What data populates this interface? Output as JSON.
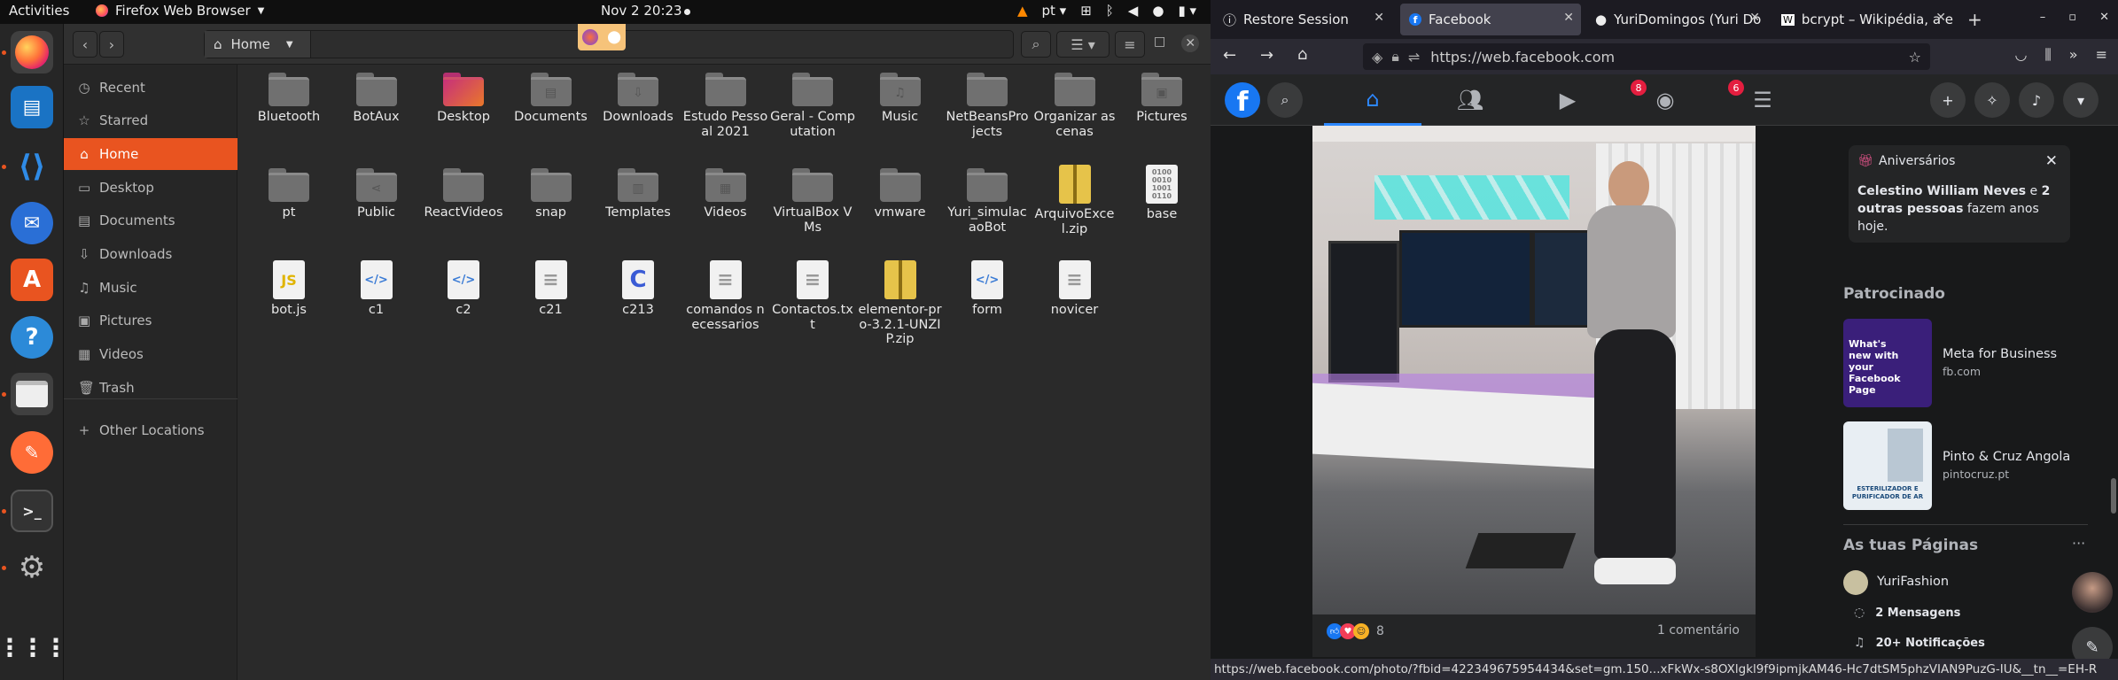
{
  "topbar": {
    "activities": "Activities",
    "app_name": "Firefox Web Browser",
    "clock": "Nov 2  20:23",
    "lang": "pt"
  },
  "nautilus": {
    "location": "Home",
    "sidebar": [
      {
        "label": "Recent",
        "icon": "clock-icon"
      },
      {
        "label": "Starred",
        "icon": "star-icon"
      },
      {
        "label": "Home",
        "icon": "home-icon",
        "selected": true
      },
      {
        "label": "Desktop",
        "icon": "desktop-icon"
      },
      {
        "label": "Documents",
        "icon": "documents-icon"
      },
      {
        "label": "Downloads",
        "icon": "download-icon"
      },
      {
        "label": "Music",
        "icon": "music-icon"
      },
      {
        "label": "Pictures",
        "icon": "pictures-icon"
      },
      {
        "label": "Videos",
        "icon": "videos-icon"
      },
      {
        "label": "Trash",
        "icon": "trash-icon"
      },
      {
        "label": "Other Locations",
        "icon": "plus-icon"
      }
    ],
    "files": [
      {
        "name": "Bluetooth",
        "kind": "folder"
      },
      {
        "name": "BotAux",
        "kind": "folder"
      },
      {
        "name": "Desktop",
        "kind": "desktop"
      },
      {
        "name": "Documents",
        "kind": "folder",
        "glyph": "▤"
      },
      {
        "name": "Downloads",
        "kind": "folder",
        "glyph": "⇩"
      },
      {
        "name": "Estudo Pessoal 2021",
        "kind": "folder"
      },
      {
        "name": "Geral - Computation",
        "kind": "folder"
      },
      {
        "name": "Music",
        "kind": "folder",
        "glyph": "♫"
      },
      {
        "name": "NetBeansProjects",
        "kind": "folder"
      },
      {
        "name": "Organizar as cenas",
        "kind": "folder"
      },
      {
        "name": "Pictures",
        "kind": "folder",
        "glyph": "▣"
      },
      {
        "name": "pt",
        "kind": "folder"
      },
      {
        "name": "Public",
        "kind": "folder",
        "glyph": "⋖"
      },
      {
        "name": "ReactVideos",
        "kind": "folder"
      },
      {
        "name": "snap",
        "kind": "folder"
      },
      {
        "name": "Templates",
        "kind": "folder",
        "glyph": "▥"
      },
      {
        "name": "Videos",
        "kind": "folder",
        "glyph": "▦"
      },
      {
        "name": "VirtualBox VMs",
        "kind": "folder"
      },
      {
        "name": "vmware",
        "kind": "folder"
      },
      {
        "name": "Yuri_simulacaoBot",
        "kind": "folder"
      },
      {
        "name": "ArquivoExcel.zip",
        "kind": "zip"
      },
      {
        "name": "base",
        "kind": "binary",
        "glyph": "0101"
      },
      {
        "name": "bot.js",
        "kind": "js",
        "glyph": "JS"
      },
      {
        "name": "c1",
        "kind": "code",
        "glyph": "</>"
      },
      {
        "name": "c2",
        "kind": "code",
        "glyph": "</>"
      },
      {
        "name": "c21",
        "kind": "text",
        "glyph": "≡"
      },
      {
        "name": "c213",
        "kind": "c",
        "glyph": "C"
      },
      {
        "name": "comandos necessarios",
        "kind": "text",
        "glyph": "≡"
      },
      {
        "name": "Contactos.txt",
        "kind": "text",
        "glyph": "≡"
      },
      {
        "name": "elementor-pro-3.2.1-UNZIP.zip",
        "kind": "zip"
      },
      {
        "name": "form",
        "kind": "code",
        "glyph": "</>"
      },
      {
        "name": "novicer",
        "kind": "text",
        "glyph": "≡"
      }
    ]
  },
  "firefox": {
    "tabs": [
      {
        "title": "Restore Session",
        "icon": "info-icon"
      },
      {
        "title": "Facebook",
        "icon": "facebook-icon",
        "selected": true
      },
      {
        "title": "YuriDomingos (Yuri Do",
        "icon": "github-icon"
      },
      {
        "title": "bcrypt – Wikipédia, a e",
        "icon": "wikipedia-icon"
      }
    ],
    "url": "https://web.facebook.com",
    "status_url": "https://web.facebook.com/photo/?fbid=422349675954434&set=gm.150...xFkWx-s8OXlgkl9f9ipmjkAM46-Hc7dtSM5phzVIAN9PuzG-IU&__tn__=EH-R"
  },
  "facebook": {
    "badges": {
      "watch": "8",
      "groups": "6"
    },
    "post": {
      "reaction_count": "8",
      "comments": "1 comentário"
    },
    "birthdays": {
      "title": "Aniversários",
      "text_name": "Celestino William Neves",
      "text_mid": " e ",
      "text_others": "2 outras pessoas",
      "text_end": " fazem anos hoje."
    },
    "sponsored_title": "Patrocinado",
    "ads": [
      {
        "title": "Meta for Business",
        "domain": "fb.com",
        "thumb_text": "What's new with your Facebook Page"
      },
      {
        "title": "Pinto & Cruz Angola",
        "domain": "pintocruz.pt",
        "thumb_text": "ESTERILIZADOR E PURIFICADOR DE AR"
      }
    ],
    "pages_title": "As tuas Páginas",
    "page": {
      "name": "YuriFashion",
      "messages": "2 Mensagens",
      "notifications": "20+ Notificações"
    }
  },
  "colors": {
    "accent": "#e95420",
    "fb_blue": "#1877f2",
    "badge_red": "#e41e3f"
  }
}
